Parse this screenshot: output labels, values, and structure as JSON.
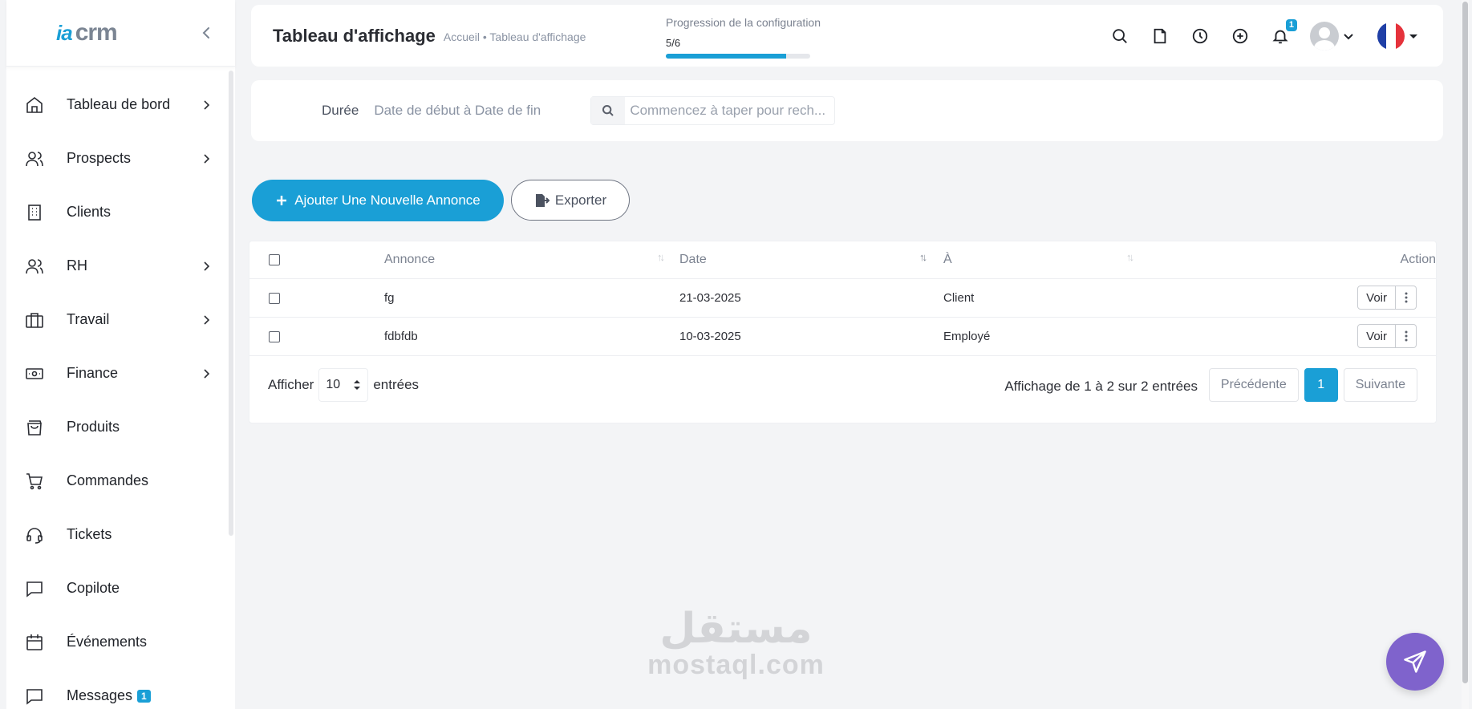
{
  "logo": {
    "ia": "ia",
    "crm": "crm"
  },
  "sidebar": {
    "items": [
      {
        "label": "Tableau de bord",
        "icon": "home-icon",
        "has_submenu": true
      },
      {
        "label": "Prospects",
        "icon": "users-icon",
        "has_submenu": true
      },
      {
        "label": "Clients",
        "icon": "building-icon",
        "has_submenu": false
      },
      {
        "label": "RH",
        "icon": "users-icon",
        "has_submenu": true
      },
      {
        "label": "Travail",
        "icon": "briefcase-icon",
        "has_submenu": true
      },
      {
        "label": "Finance",
        "icon": "money-icon",
        "has_submenu": true
      },
      {
        "label": "Produits",
        "icon": "bag-icon",
        "has_submenu": false
      },
      {
        "label": "Commandes",
        "icon": "cart-icon",
        "has_submenu": false
      },
      {
        "label": "Tickets",
        "icon": "headset-icon",
        "has_submenu": false
      },
      {
        "label": "Copilote",
        "icon": "chat-icon",
        "has_submenu": false
      },
      {
        "label": "Événements",
        "icon": "calendar-icon",
        "has_submenu": false
      },
      {
        "label": "Messages",
        "icon": "message-icon",
        "has_submenu": false,
        "badge": "1"
      }
    ]
  },
  "header": {
    "title": "Tableau d'affichage",
    "breadcrumb": "Accueil • Tableau d'affichage",
    "progress_title": "Progression de la configuration",
    "progress_count": "5/6",
    "progress_fraction": 0.8333,
    "notification_count": "1"
  },
  "filter": {
    "duration_label": "Durée",
    "date_range": "Date de début à Date de fin",
    "search_placeholder": "Commencez à taper pour rech..."
  },
  "actions": {
    "add_label": "Ajouter Une Nouvelle Annonce",
    "export_label": "Exporter"
  },
  "table": {
    "headers": {
      "annonce": "Annonce",
      "date": "Date",
      "to": "À",
      "action": "Action"
    },
    "rows": [
      {
        "annonce": "fg",
        "date": "21-03-2025",
        "to": "Client",
        "view": "Voir"
      },
      {
        "annonce": "fdbfdb",
        "date": "10-03-2025",
        "to": "Employé",
        "view": "Voir"
      }
    ],
    "show_label": "Afficher",
    "page_size": "10",
    "entries_label": "entrées",
    "info": "Affichage de 1 à 2 sur 2 entrées",
    "prev": "Précédente",
    "current_page": "1",
    "next": "Suivante"
  },
  "watermark": {
    "arabic": "مستقل",
    "latin": "mostaql.com"
  },
  "colors": {
    "accent": "#1a9fd6",
    "fab": "#7f63cc"
  }
}
